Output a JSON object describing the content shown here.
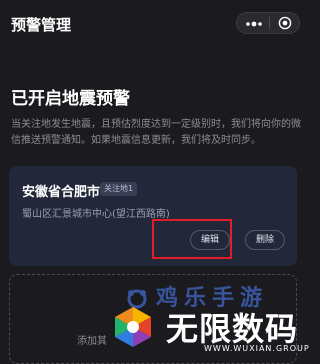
{
  "nav": {
    "title": "预警管理",
    "more_icon": "more-dots-icon",
    "target_icon": "target-icon"
  },
  "main": {
    "heading": "已开启地震预警",
    "description": "当关注地发生地震，且预估烈度达到一定级别时，我们将向你的微信推送预警通知。如果地震信息更新，我们将及时同步。"
  },
  "card": {
    "title": "安徽省合肥市",
    "tag": "关注地1",
    "address": "蜀山区汇景城市中心(望江西路南)",
    "edit_label": "编辑",
    "delete_label": "删除"
  },
  "add": {
    "label": "添加其"
  },
  "watermark": {
    "top_text": "鸡乐手游",
    "main_text": "无限数码",
    "sub_text": "WWW.WUXIAN.GROUP"
  },
  "colors": {
    "background": "#1b1b1f",
    "card": "#22273a",
    "highlight": "#e01e2a",
    "watermark_blue": "#3c5fb3"
  }
}
